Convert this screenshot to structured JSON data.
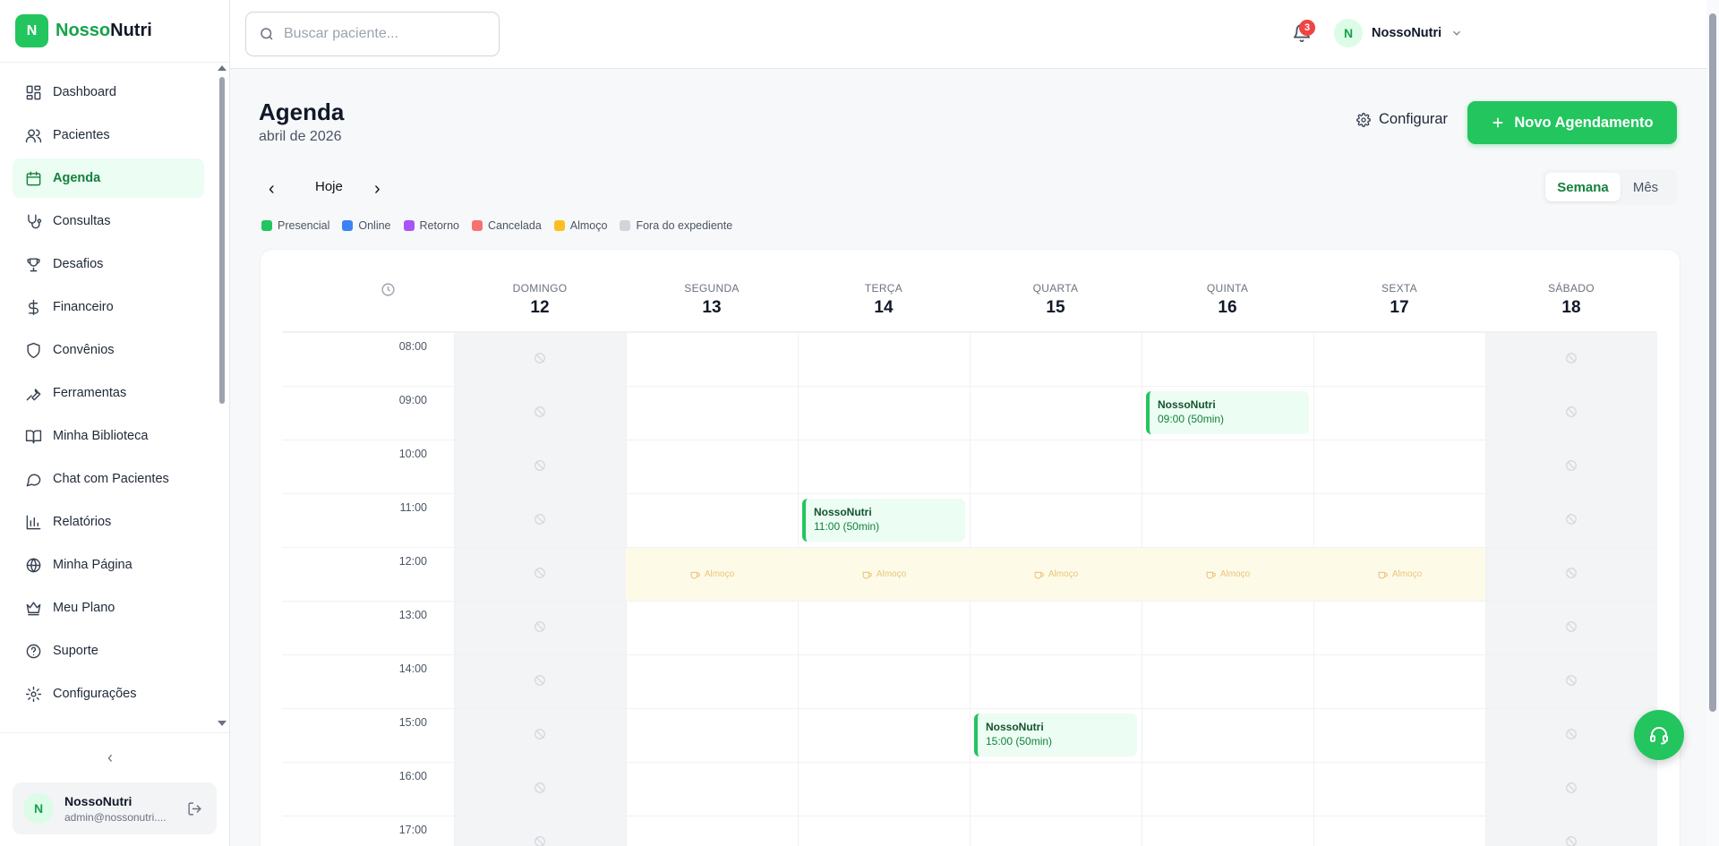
{
  "brand": {
    "badge": "N",
    "name_a": "Nosso",
    "name_b": "Nutri"
  },
  "search": {
    "placeholder": "Buscar paciente..."
  },
  "notifications": {
    "count": "3"
  },
  "top_user": {
    "initial": "N",
    "name": "NossoNutri"
  },
  "sidebar": {
    "items": [
      {
        "label": "Dashboard",
        "icon": "dashboard-icon"
      },
      {
        "label": "Pacientes",
        "icon": "users-icon"
      },
      {
        "label": "Agenda",
        "icon": "calendar-icon",
        "active": true
      },
      {
        "label": "Consultas",
        "icon": "stethoscope-icon"
      },
      {
        "label": "Desafios",
        "icon": "trophy-icon"
      },
      {
        "label": "Financeiro",
        "icon": "dollar-icon"
      },
      {
        "label": "Convênios",
        "icon": "shield-icon"
      },
      {
        "label": "Ferramentas",
        "icon": "wrench-icon"
      },
      {
        "label": "Minha Biblioteca",
        "icon": "book-icon"
      },
      {
        "label": "Chat com Pacientes",
        "icon": "chat-icon"
      },
      {
        "label": "Relatórios",
        "icon": "bar-chart-icon"
      },
      {
        "label": "Minha Página",
        "icon": "globe-icon"
      },
      {
        "label": "Meu Plano",
        "icon": "crown-icon"
      },
      {
        "label": "Suporte",
        "icon": "help-circle-icon"
      },
      {
        "label": "Configurações",
        "icon": "gear-icon"
      }
    ],
    "collapse_glyph": "‹",
    "user": {
      "initial": "N",
      "name": "NossoNutri",
      "email": "admin@nossonutri...."
    }
  },
  "page": {
    "title": "Agenda",
    "subtitle": "abril de 2026",
    "config_label": "Configurar",
    "new_label": "Novo Agendamento",
    "today_label": "Hoje",
    "prev_glyph": "‹",
    "next_glyph": "›",
    "view_week": "Semana",
    "view_month": "Mês"
  },
  "legend": [
    {
      "label": "Presencial",
      "color": "#22c55e"
    },
    {
      "label": "Online",
      "color": "#3b82f6"
    },
    {
      "label": "Retorno",
      "color": "#a855f7"
    },
    {
      "label": "Cancelada",
      "color": "#f87171"
    },
    {
      "label": "Almoço",
      "color": "#fbbf24"
    },
    {
      "label": "Fora do expediente",
      "color": "#d1d5db"
    }
  ],
  "calendar": {
    "days": [
      {
        "name": "DOMINGO",
        "num": "12",
        "closed": true
      },
      {
        "name": "SEGUNDA",
        "num": "13",
        "closed": false
      },
      {
        "name": "TERÇA",
        "num": "14",
        "closed": false
      },
      {
        "name": "QUARTA",
        "num": "15",
        "closed": false
      },
      {
        "name": "QUINTA",
        "num": "16",
        "closed": false
      },
      {
        "name": "SEXTA",
        "num": "17",
        "closed": false
      },
      {
        "name": "SÁBADO",
        "num": "18",
        "closed": true
      }
    ],
    "hours": [
      "08:00",
      "09:00",
      "10:00",
      "11:00",
      "12:00",
      "13:00",
      "14:00",
      "15:00",
      "16:00",
      "17:00"
    ],
    "lunch_label": "Almoço",
    "lunch_hour": "12:00",
    "events": [
      {
        "day": 4,
        "hour": "09:00",
        "title": "NossoNutri",
        "time": "09:00 (50min)"
      },
      {
        "day": 2,
        "hour": "11:00",
        "title": "NossoNutri",
        "time": "11:00 (50min)"
      },
      {
        "day": 3,
        "hour": "15:00",
        "title": "NossoNutri",
        "time": "15:00 (50min)"
      }
    ]
  }
}
